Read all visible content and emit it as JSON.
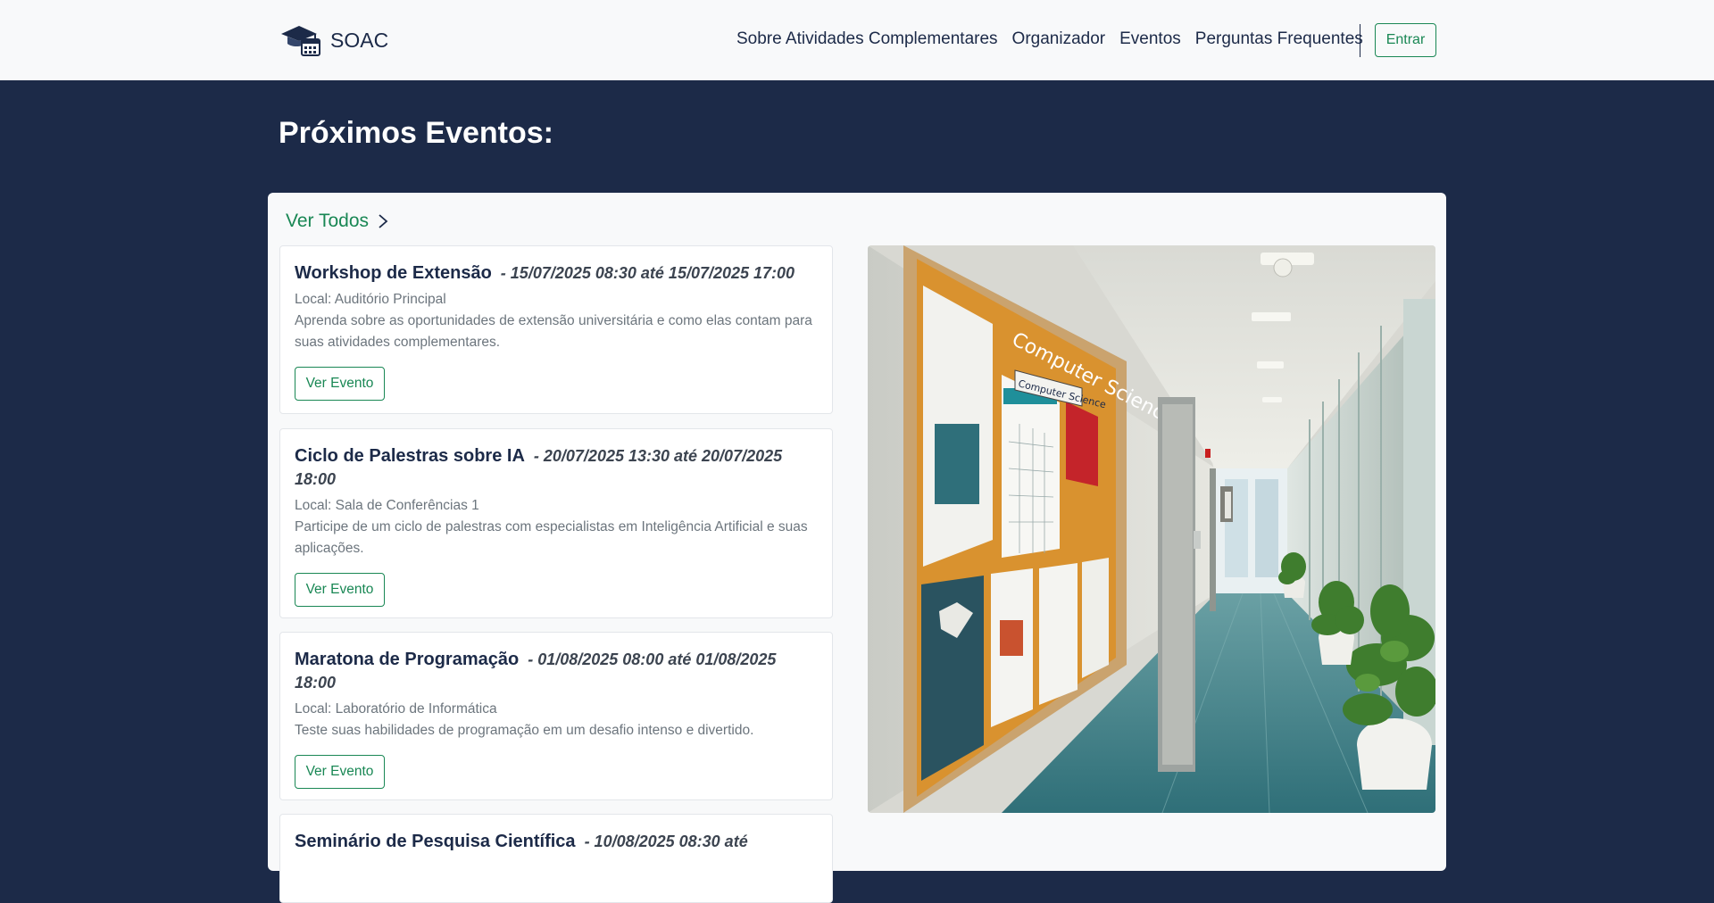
{
  "navbar": {
    "brand": "SOAC",
    "links": [
      "Sobre Atividades Complementares",
      "Organizador",
      "Eventos",
      "Perguntas Frequentes"
    ],
    "login_label": "Entrar"
  },
  "section": {
    "title": "Próximos Eventos:",
    "see_all_label": "Ver Todos"
  },
  "events": [
    {
      "title": "Workshop de Extensão",
      "date": "- 15/07/2025 08:30 até 15/07/2025 17:00",
      "local": "Local: Auditório Principal",
      "description": "Aprenda sobre as oportunidades de extensão universitária e como elas contam para suas atividades complementares.",
      "button": "Ver Evento"
    },
    {
      "title": "Ciclo de Palestras sobre IA",
      "date": "- 20/07/2025 13:30 até 20/07/2025 18:00",
      "local": "Local: Sala de Conferências 1",
      "description": "Participe de um ciclo de palestras com especialistas em Inteligência Artificial e suas aplicações.",
      "button": "Ver Evento"
    },
    {
      "title": "Maratona de Programação",
      "date": "- 01/08/2025 08:00 até 01/08/2025 18:00",
      "local": "Local: Laboratório de Informática",
      "description": "Teste suas habilidades de programação em um desafio intenso e divertido.",
      "button": "Ver Evento"
    },
    {
      "title": "Seminário de Pesquisa Científica",
      "date": "- 10/08/2025 08:30 até",
      "local": "",
      "description": "",
      "button": ""
    }
  ],
  "image": {
    "board_text": "Computer Science",
    "sign_text": "Computer Science"
  },
  "colors": {
    "navy": "#1c2a48",
    "green": "#198754",
    "light": "#f8f9fa"
  },
  "icons": {
    "logo": "graduation-cap-calendar-icon",
    "see_all": "chevron-right-icon"
  }
}
